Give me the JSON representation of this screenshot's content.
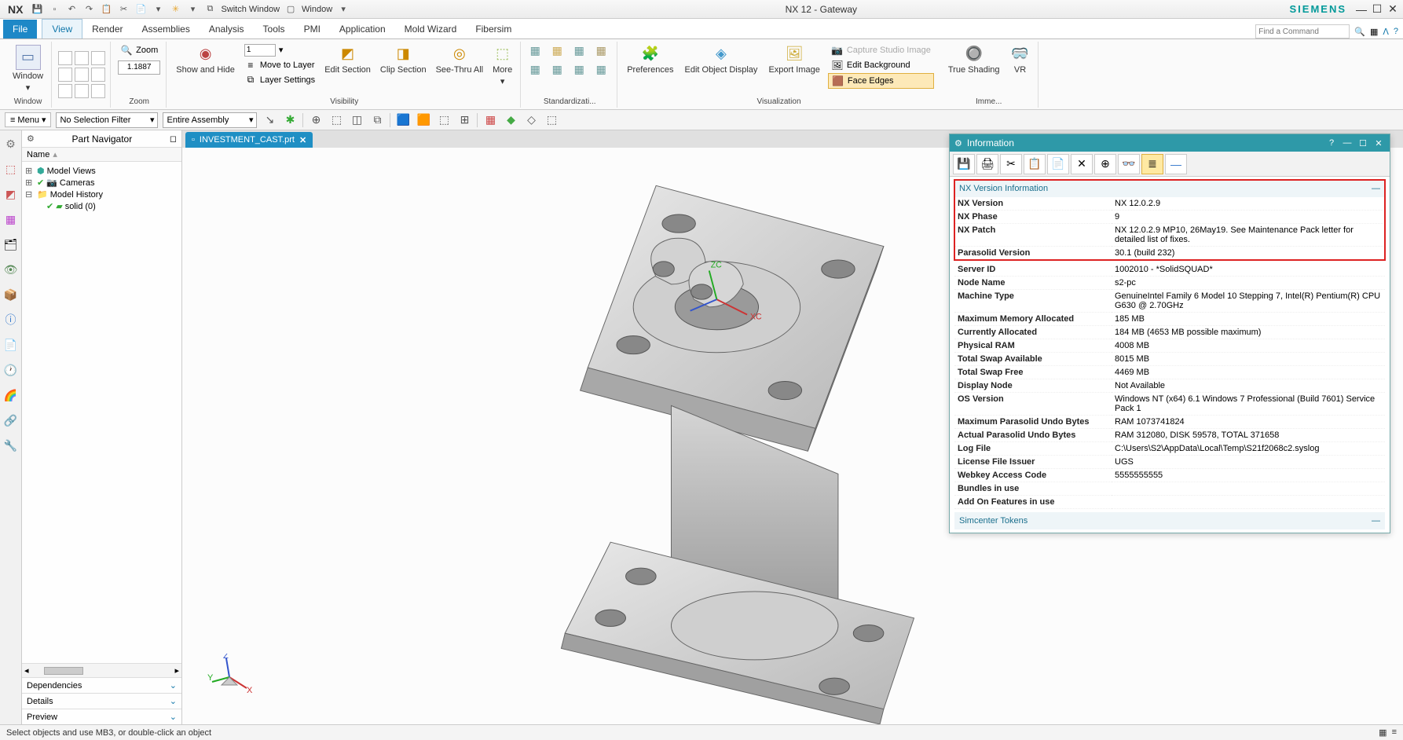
{
  "app": {
    "title": "NX 12 - Gateway",
    "logo": "NX",
    "brand": "SIEMENS"
  },
  "titlebar_buttons": [
    "Switch Window",
    "Window"
  ],
  "ribbon": {
    "tabs": [
      "File",
      "View",
      "Render",
      "Assemblies",
      "Analysis",
      "Tools",
      "PMI",
      "Application",
      "Mold Wizard",
      "Fibersim"
    ],
    "active_tab": "View",
    "find_placeholder": "Find a Command",
    "groups": {
      "window": {
        "label": "Window",
        "item": "Window"
      },
      "zoom": {
        "label": "Zoom",
        "zoom_btn": "Zoom",
        "value": "1.1887"
      },
      "visibility": {
        "label": "Visibility",
        "show_hide": "Show and Hide",
        "layer_val": "1",
        "move_to_layer": "Move to Layer",
        "layer_settings": "Layer Settings",
        "edit_section": "Edit Section",
        "clip_section": "Clip Section",
        "see_thru": "See-Thru All",
        "more": "More"
      },
      "standardization": {
        "label": "Standardizati..."
      },
      "preferences": "Preferences",
      "edit_obj": "Edit Object Display",
      "export_img": "Export Image",
      "visualization": {
        "label": "Visualization",
        "capture": "Capture Studio Image",
        "edit_bg": "Edit Background",
        "face_edges": "Face Edges"
      },
      "true_shading": "True Shading",
      "vr": "VR",
      "imme": "Imme..."
    }
  },
  "toolbar2": {
    "menu": "Menu",
    "filter": "No Selection Filter",
    "assembly": "Entire Assembly"
  },
  "nav": {
    "title": "Part Navigator",
    "col": "Name",
    "tree": {
      "model_views": "Model Views",
      "cameras": "Cameras",
      "model_history": "Model History",
      "solid": "solid (0)"
    },
    "sections": [
      "Dependencies",
      "Details",
      "Preview"
    ]
  },
  "file_tab": "INVESTMENT_CAST.prt",
  "info": {
    "title": "Information",
    "section1": "NX Version Information",
    "section2": "Simcenter Tokens",
    "rows": [
      {
        "k": "NX Version",
        "v": "NX 12.0.2.9"
      },
      {
        "k": "NX Phase",
        "v": "9"
      },
      {
        "k": "NX Patch",
        "v": "NX 12.0.2.9 MP10, 26May19. See Maintenance Pack letter for detailed list of fixes."
      },
      {
        "k": "Parasolid Version",
        "v": "30.1 (build 232)"
      },
      {
        "k": "Server ID",
        "v": "1002010 - *SolidSQUAD*"
      },
      {
        "k": "Node Name",
        "v": "s2-pc"
      },
      {
        "k": "Machine Type",
        "v": "GenuineIntel Family 6 Model 10 Stepping 7, Intel(R) Pentium(R) CPU G630 @ 2.70GHz"
      },
      {
        "k": "Maximum Memory Allocated",
        "v": "185 MB"
      },
      {
        "k": "Currently Allocated",
        "v": "184 MB (4653 MB possible maximum)"
      },
      {
        "k": "Physical RAM",
        "v": "4008 MB"
      },
      {
        "k": "Total Swap Available",
        "v": "8015 MB"
      },
      {
        "k": "Total Swap Free",
        "v": "4469 MB"
      },
      {
        "k": "Display Node",
        "v": "Not Available"
      },
      {
        "k": "OS Version",
        "v": "Windows NT (x64) 6.1 Windows 7 Professional (Build 7601) Service Pack 1"
      },
      {
        "k": "Maximum Parasolid Undo Bytes",
        "v": "RAM 1073741824"
      },
      {
        "k": "Actual Parasolid Undo Bytes",
        "v": "RAM 312080, DISK 59578, TOTAL 371658"
      },
      {
        "k": "Log File",
        "v": "C:\\Users\\S2\\AppData\\Local\\Temp\\S21f2068c2.syslog"
      },
      {
        "k": "License File Issuer",
        "v": "UGS"
      },
      {
        "k": "Webkey Access Code",
        "v": "5555555555"
      },
      {
        "k": "Bundles in use",
        "v": ""
      },
      {
        "k": "Add On Features in use",
        "v": ""
      }
    ]
  },
  "status": "Select objects and use MB3, or double-click an object"
}
